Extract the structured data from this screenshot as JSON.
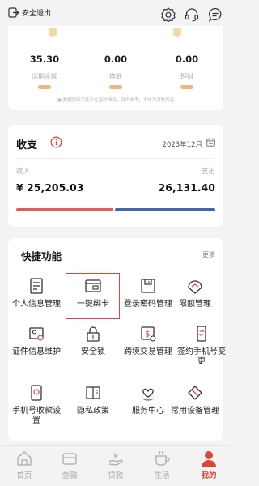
{
  "header": {
    "logout_label": "安全退出",
    "icons": [
      "gear-icon",
      "headset-icon",
      "message-icon"
    ]
  },
  "balances": {
    "items": [
      {
        "value": "35.30",
        "label": "活期余额",
        "color": "#f1b47b"
      },
      {
        "value": "0.00",
        "label": "存款",
        "color": "#f1b47b"
      },
      {
        "value": "0.00",
        "label": "理财",
        "color": "#f1b47b"
      }
    ],
    "note": "数据更新可能存在延时情况，仅供参考，不作为对账凭证"
  },
  "income_expense": {
    "title": "收支",
    "date": "2023年12月",
    "income_label": "收入",
    "expense_label": "支出",
    "income_value": "¥ 25,205.03",
    "expense_value": "26,131.40",
    "bar": {
      "income_fraction": 0.49,
      "expense_fraction": 0.51,
      "income_color": "#e35b5b",
      "expense_color": "#4764b0"
    }
  },
  "quick_functions": {
    "title": "快捷功能",
    "more": "更多",
    "items": [
      {
        "label": "个人信息管理",
        "icon": "personal-info-icon"
      },
      {
        "label": "一键绑卡",
        "icon": "bind-card-icon"
      },
      {
        "label": "登录密码管理",
        "icon": "password-icon"
      },
      {
        "label": "限额管理",
        "icon": "limit-icon"
      },
      {
        "label": "证件信息维护",
        "icon": "id-card-icon"
      },
      {
        "label": "安全锁",
        "icon": "lock-icon"
      },
      {
        "label": "跨境交易管理",
        "icon": "cross-border-icon"
      },
      {
        "label": "签约手机号变更",
        "icon": "phone-change-icon"
      },
      {
        "label": "手机号收款设置",
        "icon": "phone-receive-icon"
      },
      {
        "label": "隐私政策",
        "icon": "privacy-icon"
      },
      {
        "label": "服务中心",
        "icon": "service-icon"
      },
      {
        "label": "常用设备管理",
        "icon": "device-icon"
      }
    ]
  },
  "bottom_nav": {
    "items": [
      {
        "label": "首页",
        "icon": "home-icon"
      },
      {
        "label": "金融",
        "icon": "finance-icon"
      },
      {
        "label": "贷款",
        "icon": "loan-icon"
      },
      {
        "label": "生活",
        "icon": "life-icon"
      },
      {
        "label": "我的",
        "icon": "profile-icon"
      }
    ],
    "active_index": 4,
    "active_color": "#d9473b"
  }
}
